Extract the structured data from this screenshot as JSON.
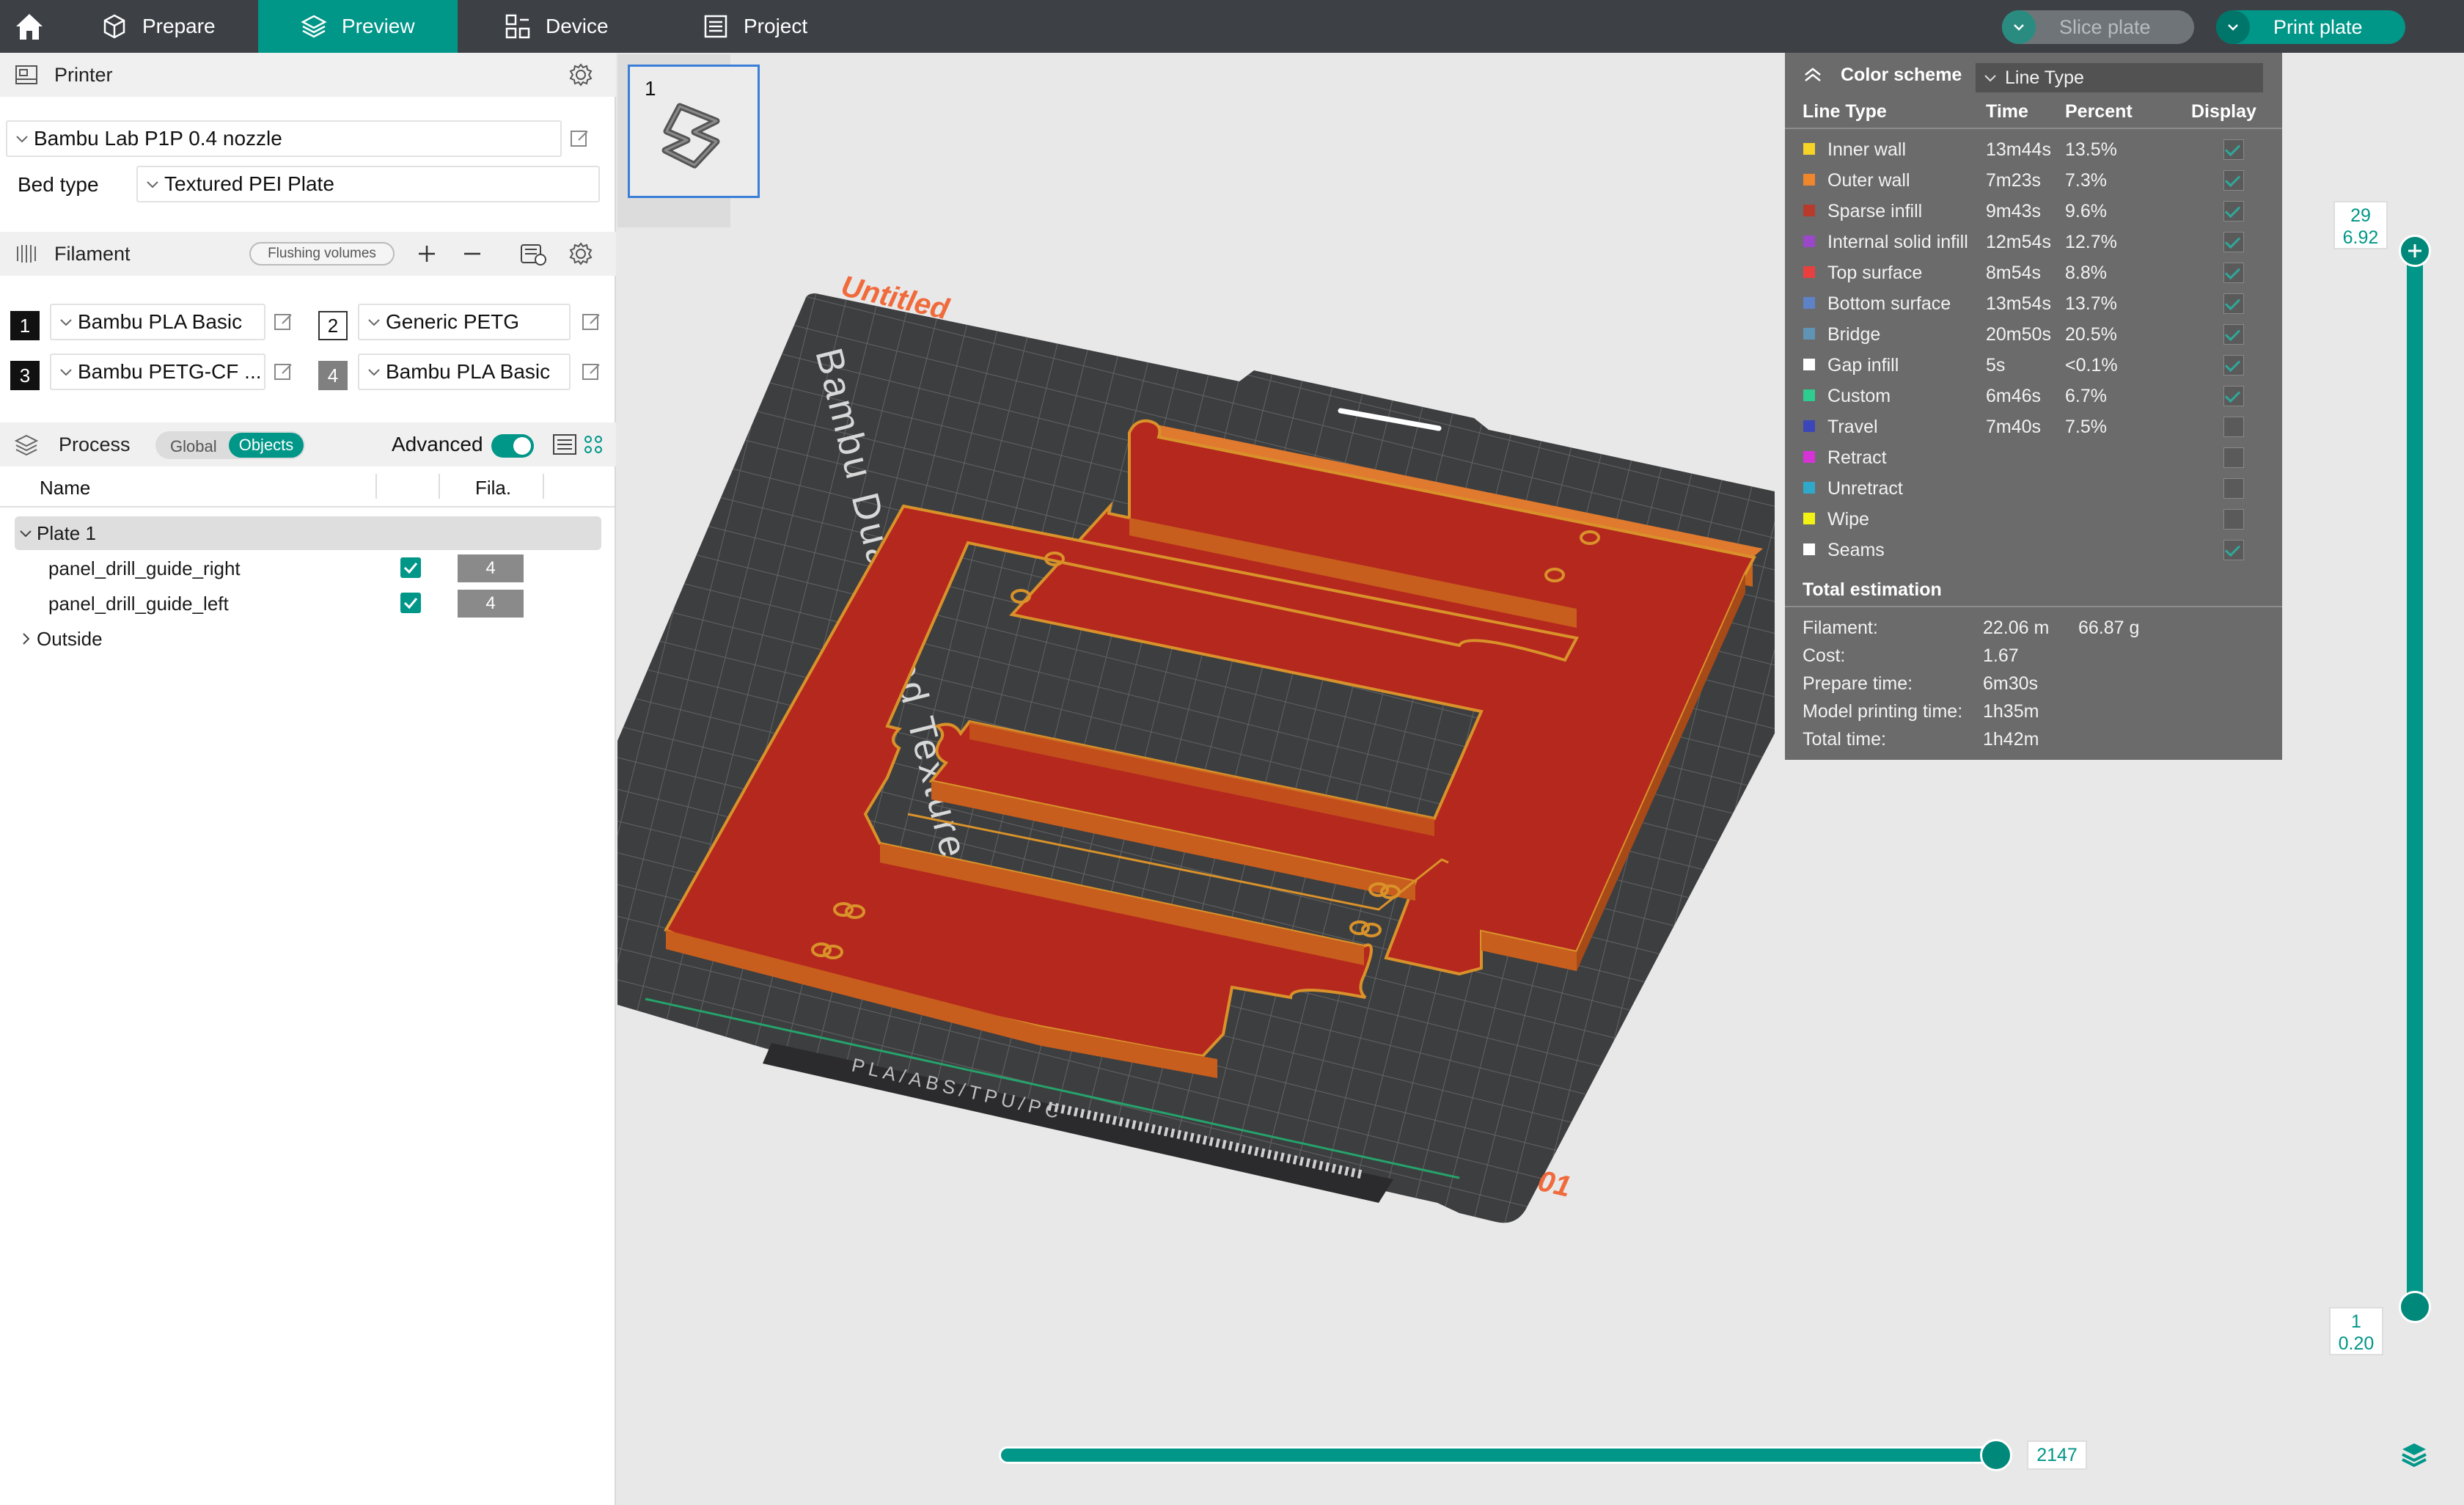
{
  "topbar": {
    "tabs": [
      {
        "label": "Prepare",
        "icon": "cube-icon"
      },
      {
        "label": "Preview",
        "icon": "layers-icon"
      },
      {
        "label": "Device",
        "icon": "device-icon"
      },
      {
        "label": "Project",
        "icon": "project-icon"
      }
    ],
    "slice_label": "Slice plate",
    "print_label": "Print plate",
    "accent": "#009688"
  },
  "printer": {
    "section_title": "Printer",
    "preset": "Bambu Lab P1P 0.4 nozzle",
    "bed_type_label": "Bed type",
    "bed_type": "Textured PEI Plate"
  },
  "filament": {
    "section_title": "Filament",
    "flushing_label": "Flushing volumes",
    "slots": [
      {
        "num": "1",
        "name": "Bambu PLA Basic",
        "color": "#111111",
        "text": "#ffffff"
      },
      {
        "num": "2",
        "name": "Generic PETG",
        "color": "#ffffff",
        "text": "#111111"
      },
      {
        "num": "3",
        "name": "Bambu PETG-CF ...",
        "color": "#111111",
        "text": "#ffffff"
      },
      {
        "num": "4",
        "name": "Bambu PLA Basic",
        "color": "#808080",
        "text": "#ffffff"
      }
    ]
  },
  "process": {
    "section_title": "Process",
    "global_label": "Global",
    "objects_label": "Objects",
    "advanced_label": "Advanced",
    "col_name": "Name",
    "col_fila": "Fila.",
    "plate_label": "Plate 1",
    "objects": [
      {
        "name": "panel_drill_guide_right",
        "fila": "4"
      },
      {
        "name": "panel_drill_guide_left",
        "fila": "4"
      }
    ],
    "outside_label": "Outside"
  },
  "plate": {
    "thumb_number": "1",
    "plate_name": "Untitled",
    "plate_number": "01",
    "bed_text": "Bambu Dual-Sided Textured PE",
    "bed_footer": "PLA/ABS/TPU/PC"
  },
  "legend": {
    "color_scheme_label": "Color scheme",
    "scheme_value": "Line Type",
    "headers": {
      "type": "Line Type",
      "time": "Time",
      "percent": "Percent",
      "display": "Display"
    },
    "rows": [
      {
        "name": "Inner wall",
        "time": "13m44s",
        "percent": "13.5%",
        "color": "#f5d327",
        "shown": true
      },
      {
        "name": "Outer wall",
        "time": "7m23s",
        "percent": "7.3%",
        "color": "#f0862c",
        "shown": true
      },
      {
        "name": "Sparse infill",
        "time": "9m43s",
        "percent": "9.6%",
        "color": "#b83a2c",
        "shown": true
      },
      {
        "name": "Internal solid infill",
        "time": "12m54s",
        "percent": "12.7%",
        "color": "#9b47c9",
        "shown": true
      },
      {
        "name": "Top surface",
        "time": "8m54s",
        "percent": "8.8%",
        "color": "#e8403f",
        "shown": true
      },
      {
        "name": "Bottom surface",
        "time": "13m54s",
        "percent": "13.7%",
        "color": "#5e82c7",
        "shown": true
      },
      {
        "name": "Bridge",
        "time": "20m50s",
        "percent": "20.5%",
        "color": "#5f94b5",
        "shown": true
      },
      {
        "name": "Gap infill",
        "time": "5s",
        "percent": "<0.1%",
        "color": "#ffffff",
        "shown": true
      },
      {
        "name": "Custom",
        "time": "6m46s",
        "percent": "6.7%",
        "color": "#2ecc8e",
        "shown": true
      },
      {
        "name": "Travel",
        "time": "7m40s",
        "percent": "7.5%",
        "color": "#3b47b8",
        "shown": false
      },
      {
        "name": "Retract",
        "time": "",
        "percent": "",
        "color": "#d633d6",
        "shown": false
      },
      {
        "name": "Unretract",
        "time": "",
        "percent": "",
        "color": "#2fa8c9",
        "shown": false
      },
      {
        "name": "Wipe",
        "time": "",
        "percent": "",
        "color": "#f2f215",
        "shown": false
      },
      {
        "name": "Seams",
        "time": "",
        "percent": "",
        "color": "#ffffff",
        "shown": true
      }
    ],
    "total_title": "Total estimation",
    "totals": [
      {
        "label": "Filament:",
        "value": "22.06 m",
        "extra": "66.87 g"
      },
      {
        "label": "Cost:",
        "value": "1.67",
        "extra": ""
      },
      {
        "label": "Prepare time:",
        "value": "6m30s",
        "extra": ""
      },
      {
        "label": "Model printing time:",
        "value": "1h35m",
        "extra": ""
      },
      {
        "label": "Total time:",
        "value": "1h42m",
        "extra": ""
      }
    ]
  },
  "layer_slider": {
    "top_layer": "29",
    "top_height": "6.92",
    "bottom_layer": "1",
    "bottom_height": "0.20"
  },
  "move_slider": {
    "value": "2147"
  }
}
